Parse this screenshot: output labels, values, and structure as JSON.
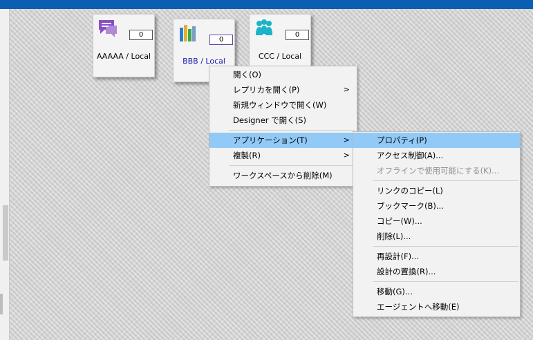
{
  "tiles": [
    {
      "name": "AAAAA",
      "scope": "Local",
      "count": "0",
      "icon": "chat-icon"
    },
    {
      "name": "BBB",
      "scope": "Local",
      "count": "0",
      "icon": "books-icon"
    },
    {
      "name": "CCC",
      "scope": "Local",
      "count": "0",
      "icon": "users-icon"
    }
  ],
  "context_menu": {
    "open": "開く(O)",
    "open_replica": "レプリカを開く(P)",
    "open_new_window": "新規ウィンドウで開く(W)",
    "open_designer": "Designer で開く(S)",
    "application": "アプリケーション(T)",
    "duplicate": "複製(R)",
    "remove_workspace": "ワークスペースから削除(M)"
  },
  "submenu": {
    "properties": "プロパティ(P)",
    "access_control": "アクセス制御(A)...",
    "offline_enable": "オフラインで使用可能にする(K)...",
    "copy_link": "リンクのコピー(L)",
    "bookmark": "ブックマーク(B)...",
    "copy": "コピー(W)...",
    "delete": "削除(L)...",
    "redesign": "再設計(F)...",
    "replace_design": "設計の置換(R)...",
    "move": "移動(G)...",
    "move_agent": "エージェントへ移動(E)"
  },
  "colors": {
    "topbar": "#0a5fb4",
    "highlight": "#91c9f7"
  }
}
